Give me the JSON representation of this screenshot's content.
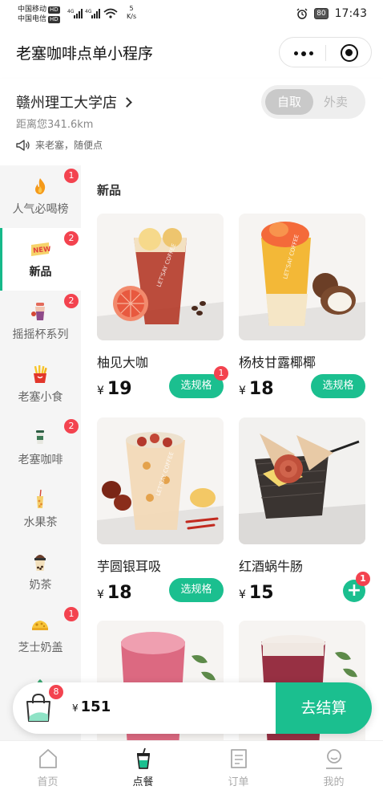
{
  "status_bar": {
    "carrier_1": "中国移动",
    "carrier_2": "中国电信",
    "hd": "HD",
    "net_speed_value": "5",
    "net_speed_unit": "K/s",
    "battery": "80",
    "time": "17:43"
  },
  "navbar": {
    "title": "老塞咖啡点单小程序"
  },
  "store": {
    "name": "赣州理工大学店",
    "distance": "距离您341.6km",
    "slogan": "来老塞，随便点",
    "mode_pickup": "自取",
    "mode_delivery": "外卖"
  },
  "categories": [
    {
      "label": "人气必喝榜",
      "badge": "1",
      "icon": "flame-icon"
    },
    {
      "label": "新品",
      "badge": "2",
      "icon": "new-icon",
      "active": true
    },
    {
      "label": "摇摇杯系列",
      "badge": "2",
      "icon": "shaker-cup-icon"
    },
    {
      "label": "老塞小食",
      "badge": "",
      "icon": "fries-icon"
    },
    {
      "label": "老塞咖啡",
      "badge": "2",
      "icon": "coffee-cup-icon"
    },
    {
      "label": "水果茶",
      "badge": "",
      "icon": "fruit-tea-icon"
    },
    {
      "label": "奶茶",
      "badge": "",
      "icon": "milk-tea-icon"
    },
    {
      "label": "芝士奶盖",
      "badge": "1",
      "icon": "cheese-icon"
    }
  ],
  "section_title": "新品",
  "products": [
    {
      "name": "柚见大咖",
      "currency": "¥",
      "price": "19",
      "action": "选规格",
      "badge": "1"
    },
    {
      "name": "杨枝甘露椰椰",
      "currency": "¥",
      "price": "18",
      "action": "选规格",
      "badge": ""
    },
    {
      "name": "芋圆银耳吸",
      "currency": "¥",
      "price": "18",
      "action": "选规格",
      "badge": ""
    },
    {
      "name": "红酒蜗牛肠",
      "currency": "¥",
      "price": "15",
      "action": "+",
      "badge": "1"
    }
  ],
  "cart": {
    "count": "8",
    "currency": "¥",
    "total": "151",
    "checkout": "去结算"
  },
  "tabs": [
    {
      "label": "首页",
      "icon": "home-icon"
    },
    {
      "label": "点餐",
      "icon": "order-cup-icon",
      "active": true
    },
    {
      "label": "订单",
      "icon": "order-list-icon"
    },
    {
      "label": "我的",
      "icon": "profile-icon"
    }
  ],
  "colors": {
    "accent": "#1bbf8f",
    "badge": "#f3434f",
    "sidebar_bg": "#f5f5f5"
  }
}
